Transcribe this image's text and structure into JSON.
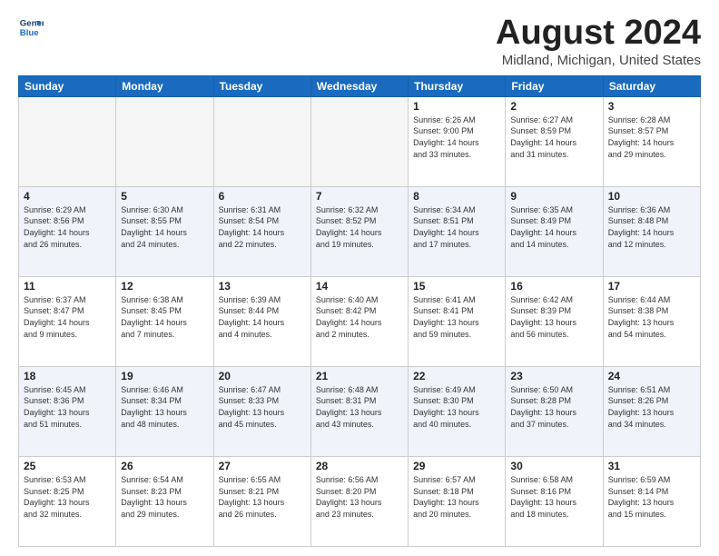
{
  "logo": {
    "line1": "General",
    "line2": "Blue"
  },
  "header": {
    "month": "August 2024",
    "location": "Midland, Michigan, United States"
  },
  "weekdays": [
    "Sunday",
    "Monday",
    "Tuesday",
    "Wednesday",
    "Thursday",
    "Friday",
    "Saturday"
  ],
  "weeks": [
    [
      {
        "day": "",
        "info": ""
      },
      {
        "day": "",
        "info": ""
      },
      {
        "day": "",
        "info": ""
      },
      {
        "day": "",
        "info": ""
      },
      {
        "day": "1",
        "info": "Sunrise: 6:26 AM\nSunset: 9:00 PM\nDaylight: 14 hours\nand 33 minutes."
      },
      {
        "day": "2",
        "info": "Sunrise: 6:27 AM\nSunset: 8:59 PM\nDaylight: 14 hours\nand 31 minutes."
      },
      {
        "day": "3",
        "info": "Sunrise: 6:28 AM\nSunset: 8:57 PM\nDaylight: 14 hours\nand 29 minutes."
      }
    ],
    [
      {
        "day": "4",
        "info": "Sunrise: 6:29 AM\nSunset: 8:56 PM\nDaylight: 14 hours\nand 26 minutes."
      },
      {
        "day": "5",
        "info": "Sunrise: 6:30 AM\nSunset: 8:55 PM\nDaylight: 14 hours\nand 24 minutes."
      },
      {
        "day": "6",
        "info": "Sunrise: 6:31 AM\nSunset: 8:54 PM\nDaylight: 14 hours\nand 22 minutes."
      },
      {
        "day": "7",
        "info": "Sunrise: 6:32 AM\nSunset: 8:52 PM\nDaylight: 14 hours\nand 19 minutes."
      },
      {
        "day": "8",
        "info": "Sunrise: 6:34 AM\nSunset: 8:51 PM\nDaylight: 14 hours\nand 17 minutes."
      },
      {
        "day": "9",
        "info": "Sunrise: 6:35 AM\nSunset: 8:49 PM\nDaylight: 14 hours\nand 14 minutes."
      },
      {
        "day": "10",
        "info": "Sunrise: 6:36 AM\nSunset: 8:48 PM\nDaylight: 14 hours\nand 12 minutes."
      }
    ],
    [
      {
        "day": "11",
        "info": "Sunrise: 6:37 AM\nSunset: 8:47 PM\nDaylight: 14 hours\nand 9 minutes."
      },
      {
        "day": "12",
        "info": "Sunrise: 6:38 AM\nSunset: 8:45 PM\nDaylight: 14 hours\nand 7 minutes."
      },
      {
        "day": "13",
        "info": "Sunrise: 6:39 AM\nSunset: 8:44 PM\nDaylight: 14 hours\nand 4 minutes."
      },
      {
        "day": "14",
        "info": "Sunrise: 6:40 AM\nSunset: 8:42 PM\nDaylight: 14 hours\nand 2 minutes."
      },
      {
        "day": "15",
        "info": "Sunrise: 6:41 AM\nSunset: 8:41 PM\nDaylight: 13 hours\nand 59 minutes."
      },
      {
        "day": "16",
        "info": "Sunrise: 6:42 AM\nSunset: 8:39 PM\nDaylight: 13 hours\nand 56 minutes."
      },
      {
        "day": "17",
        "info": "Sunrise: 6:44 AM\nSunset: 8:38 PM\nDaylight: 13 hours\nand 54 minutes."
      }
    ],
    [
      {
        "day": "18",
        "info": "Sunrise: 6:45 AM\nSunset: 8:36 PM\nDaylight: 13 hours\nand 51 minutes."
      },
      {
        "day": "19",
        "info": "Sunrise: 6:46 AM\nSunset: 8:34 PM\nDaylight: 13 hours\nand 48 minutes."
      },
      {
        "day": "20",
        "info": "Sunrise: 6:47 AM\nSunset: 8:33 PM\nDaylight: 13 hours\nand 45 minutes."
      },
      {
        "day": "21",
        "info": "Sunrise: 6:48 AM\nSunset: 8:31 PM\nDaylight: 13 hours\nand 43 minutes."
      },
      {
        "day": "22",
        "info": "Sunrise: 6:49 AM\nSunset: 8:30 PM\nDaylight: 13 hours\nand 40 minutes."
      },
      {
        "day": "23",
        "info": "Sunrise: 6:50 AM\nSunset: 8:28 PM\nDaylight: 13 hours\nand 37 minutes."
      },
      {
        "day": "24",
        "info": "Sunrise: 6:51 AM\nSunset: 8:26 PM\nDaylight: 13 hours\nand 34 minutes."
      }
    ],
    [
      {
        "day": "25",
        "info": "Sunrise: 6:53 AM\nSunset: 8:25 PM\nDaylight: 13 hours\nand 32 minutes."
      },
      {
        "day": "26",
        "info": "Sunrise: 6:54 AM\nSunset: 8:23 PM\nDaylight: 13 hours\nand 29 minutes."
      },
      {
        "day": "27",
        "info": "Sunrise: 6:55 AM\nSunset: 8:21 PM\nDaylight: 13 hours\nand 26 minutes."
      },
      {
        "day": "28",
        "info": "Sunrise: 6:56 AM\nSunset: 8:20 PM\nDaylight: 13 hours\nand 23 minutes."
      },
      {
        "day": "29",
        "info": "Sunrise: 6:57 AM\nSunset: 8:18 PM\nDaylight: 13 hours\nand 20 minutes."
      },
      {
        "day": "30",
        "info": "Sunrise: 6:58 AM\nSunset: 8:16 PM\nDaylight: 13 hours\nand 18 minutes."
      },
      {
        "day": "31",
        "info": "Sunrise: 6:59 AM\nSunset: 8:14 PM\nDaylight: 13 hours\nand 15 minutes."
      }
    ]
  ]
}
